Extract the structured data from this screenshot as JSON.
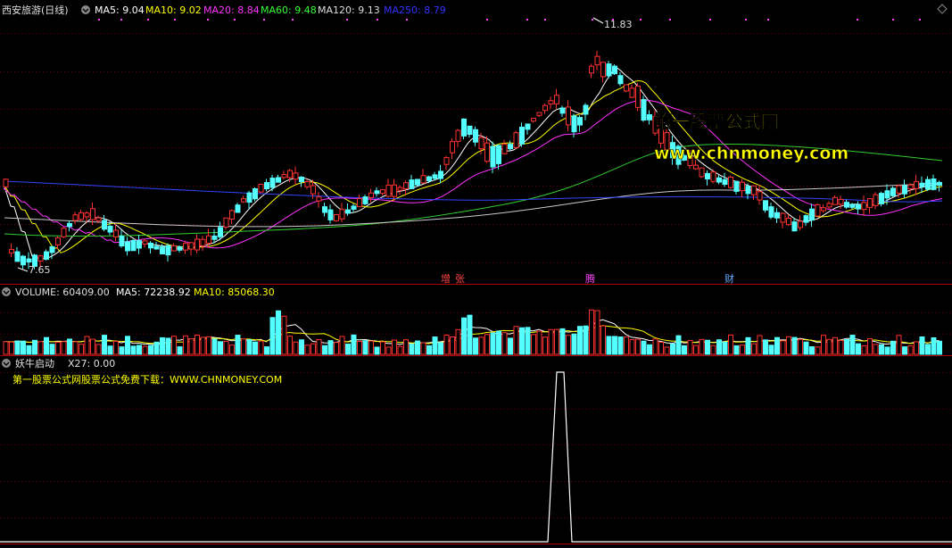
{
  "main_panel": {
    "stock_name": "西安旅游(日线)",
    "ma_values": [
      {
        "label": "MA5: 9.04",
        "color": "#ffffff"
      },
      {
        "label": "MA10: 9.02",
        "color": "#ffff00"
      },
      {
        "label": "MA20: 8.84",
        "color": "#ff33ff"
      },
      {
        "label": "MA60: 9.48",
        "color": "#33ff33"
      },
      {
        "label": "MA120: 9.13",
        "color": "#dddddd"
      },
      {
        "label": "MA250: 8.79",
        "color": "#3333ff"
      }
    ],
    "high_label": "11.83",
    "low_label": "7.65",
    "events": [
      {
        "label": "增",
        "color": "#ff4444"
      },
      {
        "label": "张",
        "color": "#ff4444"
      },
      {
        "label": "腾",
        "color": "#ff44ff"
      },
      {
        "label": "财",
        "color": "#66aaff"
      }
    ],
    "watermark_title": "第一股票公式网",
    "watermark_url": "www.chnmoney.com"
  },
  "volume_panel": {
    "label": "VOLUME: 60409.00",
    "ma5": "MA5: 72238.92",
    "ma10": "MA10: 85068.30"
  },
  "indicator_panel": {
    "name": "妖牛启动",
    "value": "X27: 0.00",
    "note": "第一股票公式网股票公式免费下载：WWW.CHNMONEY.COM"
  },
  "colors": {
    "up": "#ff3232",
    "down": "#54ffff",
    "grid": "#8b0000",
    "border": "#aa0000"
  }
}
